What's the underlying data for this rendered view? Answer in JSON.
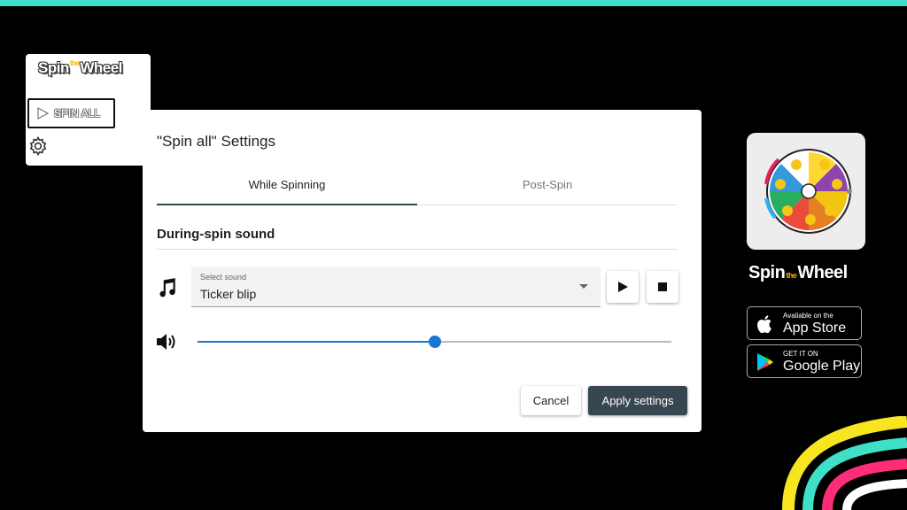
{
  "colors": {
    "top_bar": "#3fe0c8",
    "primary": "#37474f",
    "slider": "#1976d2"
  },
  "sidebar": {
    "logo": {
      "part1": "Spin",
      "part2": "the",
      "part3": "Wheel"
    },
    "spin_all_label": "SPIN ALL"
  },
  "dialog": {
    "title": "\"Spin all\" Settings",
    "tabs": [
      {
        "label": "While Spinning",
        "active": true
      },
      {
        "label": "Post-Spin",
        "active": false
      }
    ],
    "section_title": "During-spin sound",
    "select": {
      "label": "Select sound",
      "value": "Ticker blip"
    },
    "volume_fraction": 0.5,
    "cancel_label": "Cancel",
    "apply_label": "Apply settings"
  },
  "promo": {
    "brand": {
      "part1": "Spin",
      "part2": "the",
      "part3": "Wheel"
    },
    "appstore": {
      "small": "Available on the",
      "big": "App Store"
    },
    "googleplay": {
      "small": "GET IT ON",
      "big": "Google Play"
    }
  }
}
